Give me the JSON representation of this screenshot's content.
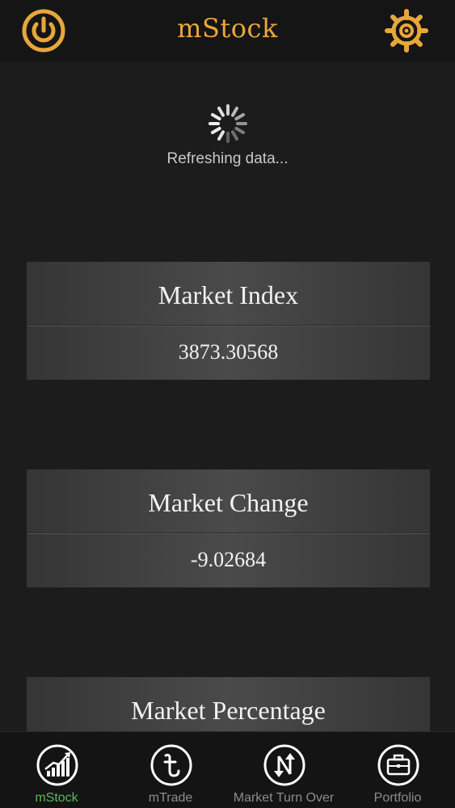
{
  "header": {
    "title": "mStock",
    "left_icon": "power-icon",
    "right_icon": "gear-icon"
  },
  "status": {
    "loading_text": "Refreshing data..."
  },
  "cards": [
    {
      "title": "Market Index",
      "value": "3873.30568"
    },
    {
      "title": "Market Change",
      "value": "-9.02684"
    },
    {
      "title": "Market Percentage",
      "value": ""
    }
  ],
  "tabs": [
    {
      "label": "mStock",
      "icon": "growth-chart-icon",
      "active": true
    },
    {
      "label": "mTrade",
      "icon": "taka-icon",
      "active": false
    },
    {
      "label": "Market Turn Over",
      "icon": "up-down-arrows-icon",
      "active": false
    },
    {
      "label": "Portfolio",
      "icon": "briefcase-icon",
      "active": false
    }
  ],
  "colors": {
    "accent": "#e8a73a",
    "active_tab": "#5cb85c",
    "background": "#1c1c1c"
  }
}
